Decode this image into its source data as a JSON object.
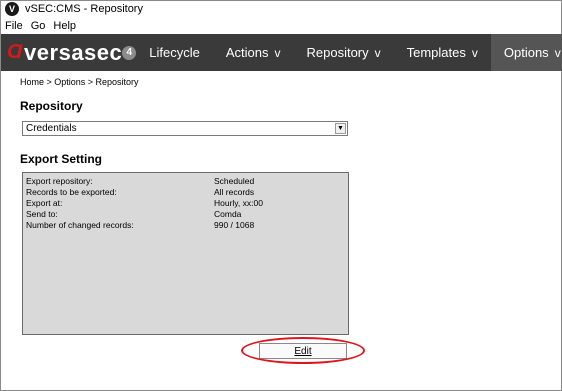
{
  "window": {
    "title": "vSEC:CMS - Repository",
    "icon_letter": "V"
  },
  "menubar": {
    "items": [
      "File",
      "Go",
      "Help"
    ]
  },
  "navbar": {
    "logo_text": "versasec",
    "badge_count": "4",
    "items": [
      {
        "label": "Lifecycle",
        "chevron": ""
      },
      {
        "label": "Actions",
        "chevron": "v"
      },
      {
        "label": "Repository",
        "chevron": "v"
      },
      {
        "label": "Templates",
        "chevron": "v"
      },
      {
        "label": "Options",
        "chevron": "v"
      }
    ],
    "active_item": "Options"
  },
  "breadcrumb": "Home > Options > Repository",
  "repository": {
    "heading": "Repository",
    "selected": "Credentials"
  },
  "export": {
    "heading": "Export Setting",
    "rows": [
      {
        "label": "Export repository:",
        "value": "Scheduled"
      },
      {
        "label": "Records to be exported:",
        "value": "All records"
      },
      {
        "label": "Export at:",
        "value": "Hourly, xx:00"
      },
      {
        "label": "Send to:",
        "value": "Comda"
      },
      {
        "label": "Number of changed records:",
        "value": "990 / 1068"
      }
    ]
  },
  "edit_button": {
    "label": "Edit"
  },
  "colors": {
    "nav_bg": "#3a3a3a",
    "nav_active": "#555555",
    "brand_red": "#d2191b",
    "panel_bg": "#d9d9d9",
    "highlight": "#e0141e"
  },
  "icons": {
    "app_icon": "vsec-logo-icon",
    "dropdown_arrow": "chevron-down-icon"
  }
}
